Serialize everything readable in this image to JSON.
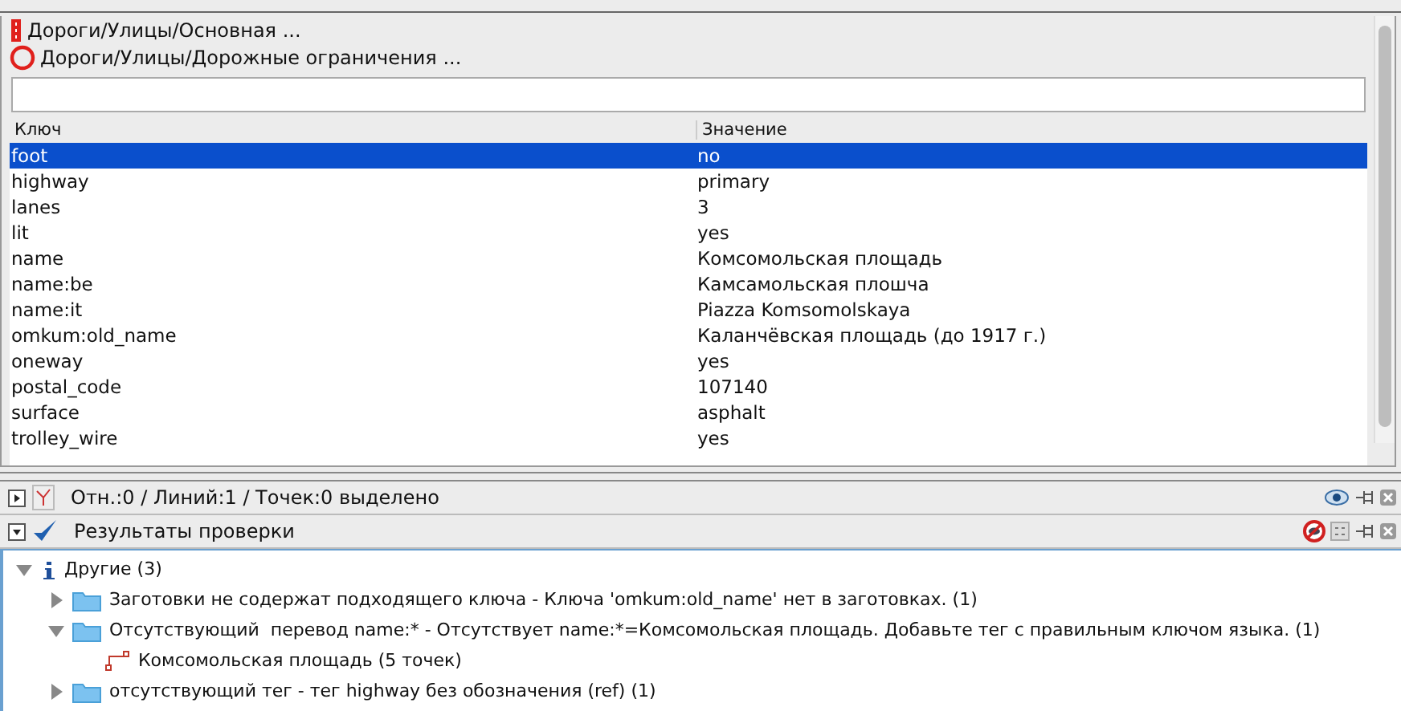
{
  "presets": [
    {
      "kind": "bar",
      "label": "Дороги/Улицы/Основная ..."
    },
    {
      "kind": "ring",
      "label": "Дороги/Улицы/Дорожные ограничения ..."
    }
  ],
  "table": {
    "columns": [
      "Ключ",
      "Значение"
    ],
    "rows": [
      {
        "key": "foot",
        "value": "no",
        "selected": true
      },
      {
        "key": "highway",
        "value": "primary",
        "selected": false
      },
      {
        "key": "lanes",
        "value": "3",
        "selected": false
      },
      {
        "key": "lit",
        "value": "yes",
        "selected": false
      },
      {
        "key": "name",
        "value": "Комсомольская площадь",
        "selected": false
      },
      {
        "key": "name:be",
        "value": "Камсамольская плошча",
        "selected": false
      },
      {
        "key": "name:it",
        "value": "Piazza Komsomolskaya",
        "selected": false
      },
      {
        "key": "omkum:old_name",
        "value": "Каланчёвская площадь (до 1917 г.)",
        "selected": false
      },
      {
        "key": "oneway",
        "value": "yes",
        "selected": false
      },
      {
        "key": "postal_code",
        "value": "107140",
        "selected": false
      },
      {
        "key": "surface",
        "value": "asphalt",
        "selected": false
      },
      {
        "key": "trolley_wire",
        "value": "yes",
        "selected": false
      }
    ]
  },
  "panels": [
    {
      "title": "Отн.:0 / Линий:1 / Точек:0 выделено",
      "expanded": false,
      "kind": "selection"
    },
    {
      "title": "Результаты проверки",
      "expanded": true,
      "kind": "validation"
    }
  ],
  "tree": [
    {
      "kind": "info",
      "label": "Другие (3)",
      "expanded": true,
      "children": [
        {
          "kind": "folder",
          "label": "Заготовки не содержат подходящего ключа - Ключа 'omkum:old_name' нет в заготовках. (1)",
          "expanded": false
        },
        {
          "kind": "folder",
          "label": "Отсутствующий  перевод name:* - Отсутствует name:*=Комсомольская площадь. Добавьте тег с правильным ключом языка. (1)",
          "expanded": true,
          "children": [
            {
              "kind": "way",
              "label": "Комсомольская площадь (5 точек)"
            }
          ]
        },
        {
          "kind": "folder",
          "label": "отсутствующий тег - тег highway без обозначения (ref) (1)",
          "expanded": false
        }
      ]
    }
  ]
}
